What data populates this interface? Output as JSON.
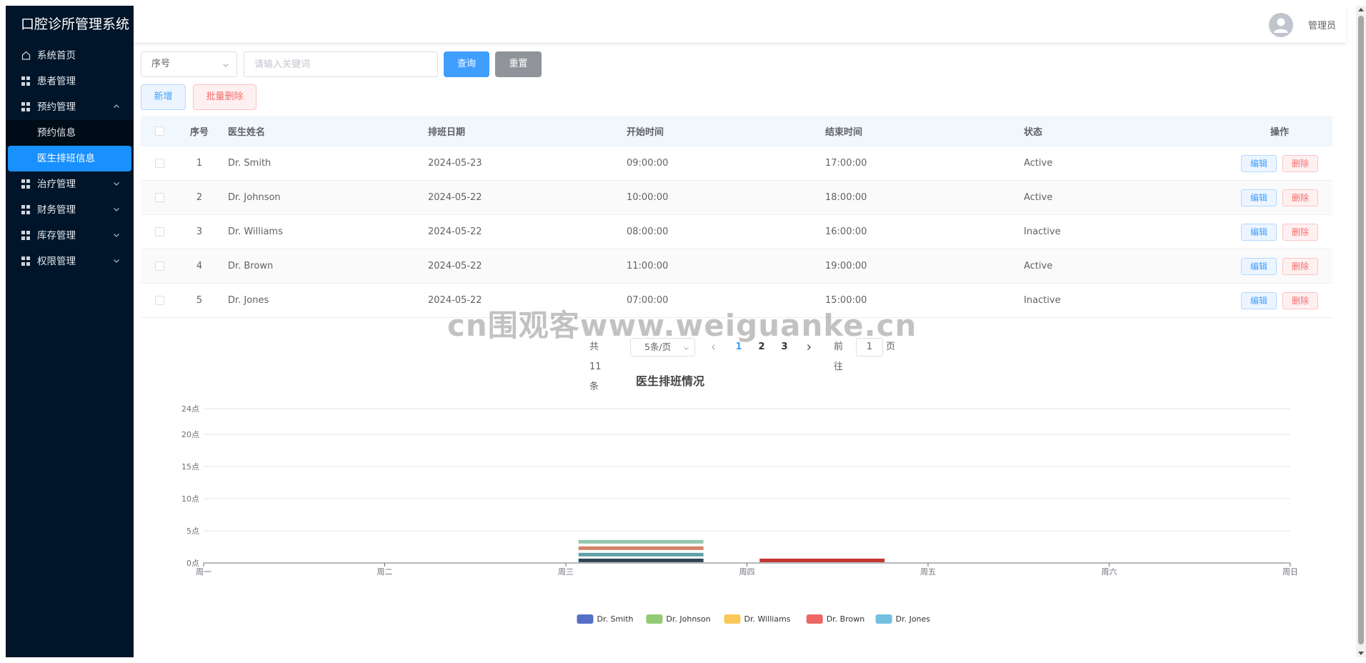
{
  "app": {
    "title": "口腔诊所管理系统"
  },
  "sidebar": {
    "items": [
      {
        "label": "系统首页",
        "icon": "home-icon"
      },
      {
        "label": "患者管理",
        "icon": "grid-icon"
      },
      {
        "label": "预约管理",
        "icon": "grid-icon",
        "expanded": true,
        "children": [
          {
            "label": "预约信息"
          },
          {
            "label": "医生排班信息",
            "active": true
          }
        ]
      },
      {
        "label": "治疗管理",
        "icon": "grid-icon"
      },
      {
        "label": "财务管理",
        "icon": "grid-icon"
      },
      {
        "label": "库存管理",
        "icon": "grid-icon"
      },
      {
        "label": "权限管理",
        "icon": "grid-icon"
      }
    ]
  },
  "header": {
    "user_name": "管理员"
  },
  "toolbar": {
    "search_field": "序号",
    "search_placeholder": "请输入关键词",
    "query_label": "查询",
    "reset_label": "重置",
    "add_label": "新增",
    "batch_delete_label": "批量删除"
  },
  "table": {
    "columns": [
      "序号",
      "医生姓名",
      "排班日期",
      "开始时间",
      "结束时间",
      "状态",
      "操作"
    ],
    "edit_label": "编辑",
    "delete_label": "删除",
    "rows": [
      {
        "idx": "1",
        "name": "Dr. Smith",
        "date": "2024-05-23",
        "start": "09:00:00",
        "end": "17:00:00",
        "status": "Active"
      },
      {
        "idx": "2",
        "name": "Dr. Johnson",
        "date": "2024-05-22",
        "start": "10:00:00",
        "end": "18:00:00",
        "status": "Active"
      },
      {
        "idx": "3",
        "name": "Dr. Williams",
        "date": "2024-05-22",
        "start": "08:00:00",
        "end": "16:00:00",
        "status": "Inactive"
      },
      {
        "idx": "4",
        "name": "Dr. Brown",
        "date": "2024-05-22",
        "start": "11:00:00",
        "end": "19:00:00",
        "status": "Active"
      },
      {
        "idx": "5",
        "name": "Dr. Jones",
        "date": "2024-05-22",
        "start": "07:00:00",
        "end": "15:00:00",
        "status": "Inactive"
      }
    ]
  },
  "pagination": {
    "total_text": "共 11 条",
    "page_size": "5条/页",
    "pages": [
      "1",
      "2",
      "3"
    ],
    "current_page": "1",
    "goto_prefix": "前往",
    "goto_value": "1",
    "goto_suffix": "页"
  },
  "watermark": "cn围观客www.weiguanke.cn",
  "chart_data": {
    "type": "bar",
    "title": "医生排班情况",
    "categories": [
      "周一",
      "周二",
      "周三",
      "周四",
      "周五",
      "周六",
      "周日"
    ],
    "y_ticks": [
      "0点",
      "5点",
      "10点",
      "15点",
      "20点",
      "24点"
    ],
    "y_tick_values": [
      0,
      5,
      10,
      15,
      20,
      24
    ],
    "ylim": [
      0,
      24
    ],
    "grid": true,
    "legend_position": "bottom",
    "series": [
      {
        "name": "Dr. Smith",
        "color": "#5470c6",
        "bars": [
          {
            "category": "周三",
            "value": 0.4,
            "color": "#2f4554"
          }
        ]
      },
      {
        "name": "Dr. Johnson",
        "color": "#91cc75",
        "bars": [
          {
            "category": "周三",
            "value": 1.3,
            "color": "#61a0a8"
          }
        ]
      },
      {
        "name": "Dr. Williams",
        "color": "#fac858",
        "bars": [
          {
            "category": "周三",
            "value": 2.3,
            "color": "#d48265"
          }
        ]
      },
      {
        "name": "Dr. Brown",
        "color": "#ee6666",
        "bars": [
          {
            "category": "周三",
            "value": 3.3,
            "color": "#91c7ae"
          },
          {
            "category": "周四",
            "value": 0.4,
            "color": "#c23531"
          }
        ]
      },
      {
        "name": "Dr. Jones",
        "color": "#73c0de",
        "bars": []
      }
    ]
  }
}
